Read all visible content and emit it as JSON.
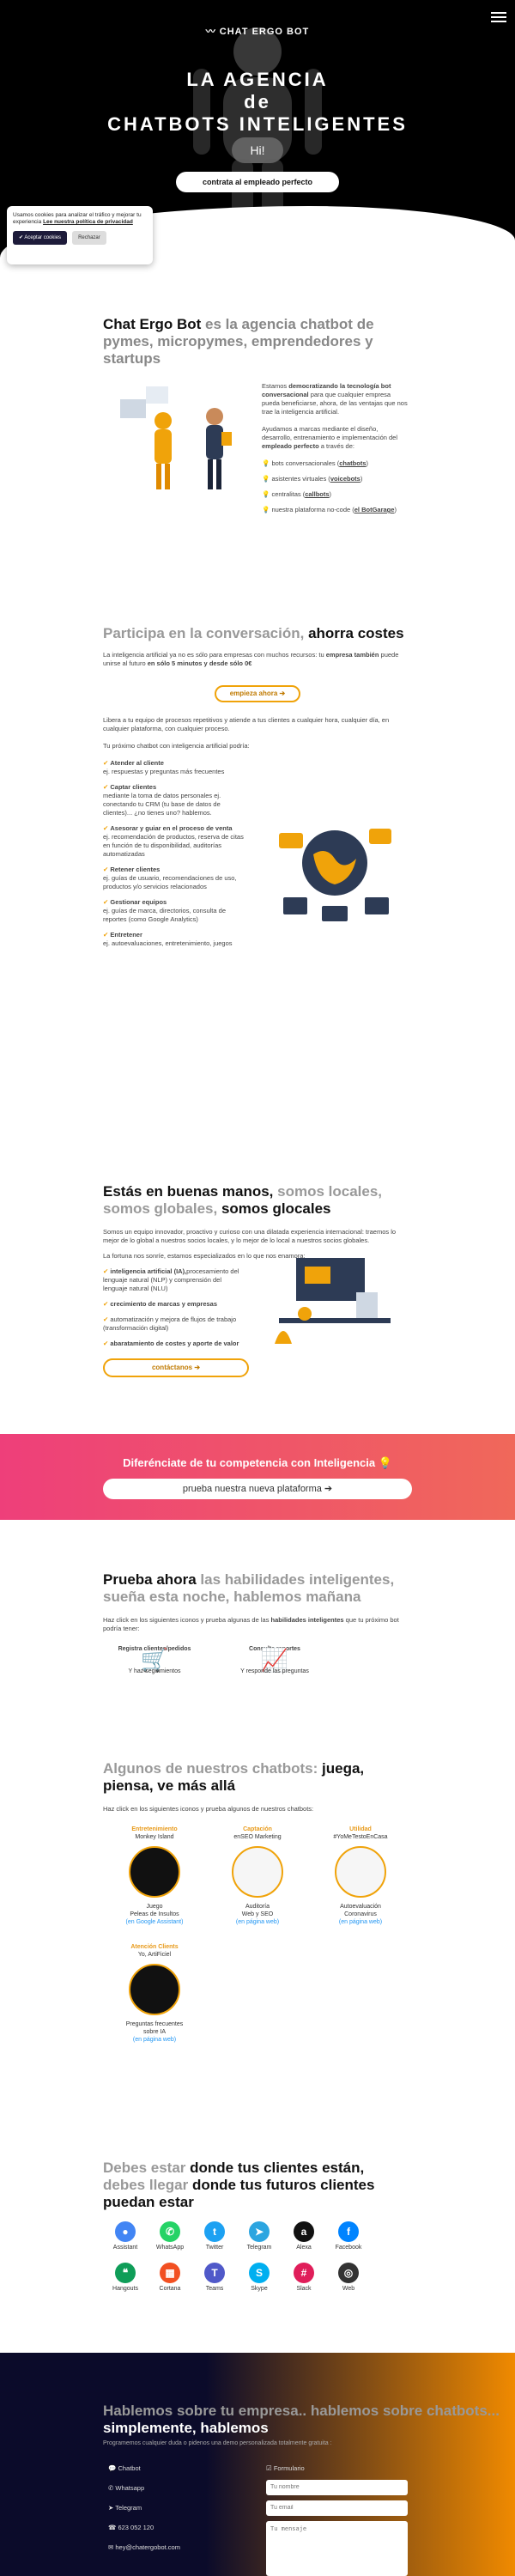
{
  "header": {
    "logo_text": "CHAT ERGO BOT",
    "title_line1": "LA AGENCIA",
    "title_line2": "de",
    "title_line3": "CHATBOTS INTELIGENTES",
    "bubble": "Hi!",
    "cta": "contrata al empleado perfecto"
  },
  "cookie": {
    "text": "Usamos cookies para analizar el tráfico y mejorar tu experiencia",
    "link": "Lee nuestra política de privacidad",
    "accept": "✔ Aceptar cookies",
    "reject": "Rechazar"
  },
  "intro": {
    "title_strong": "Chat Ergo Bot",
    "title_rest": "es la agencia chatbot de pymes, micropymes, emprendedores y startups",
    "p1_pre": "Estamos",
    "p1_b": "democratizando la tecnología bot conversacional",
    "p1_post": "para que cualquier empresa pueda beneficiarse, ahora, de las ventajas que nos trae la inteligencia artificial.",
    "p2_pre": "Ayudamos a marcas mediante el diseño, desarrollo, entrenamiento e implementación del",
    "p2_b": "empleado perfecto",
    "p2_post": "a través de:",
    "items": [
      {
        "pre": "bots conversacionales (",
        "link": "chatbots",
        "post": ")"
      },
      {
        "pre": "asistentes virtuales (",
        "link": "voicebots",
        "post": ")"
      },
      {
        "pre": "centralitas (",
        "link": "callbots",
        "post": ")"
      },
      {
        "pre": "nuestra plataforma no-code (",
        "link": "el BotGarage",
        "post": ")"
      }
    ]
  },
  "conv": {
    "title_g": "Participa en la conversación,",
    "title_b": "ahorra costes",
    "p1_pre": "La inteligencia artificial ya no es sólo para empresas con muchos recursos: tu",
    "p1_b": "empresa también",
    "p1_mid": "puede unirse al futuro",
    "p1_b2": "en sólo 5 minutos y desde sólo 0€",
    "btn": "empieza ahora ➔",
    "p2": "Libera a tu equipo de procesos repetitivos y atiende a tus clientes a cualquier hora, cualquier día, en cualquier plataforma, con cualquier proceso.",
    "p3": "Tu próximo chatbot con inteligencia artificial podría:",
    "features": [
      {
        "title": "Atender al cliente",
        "desc": "ej. respuestas y preguntas más frecuentes"
      },
      {
        "title": "Captar clientes",
        "desc": "mediante la toma de datos personales ej. conectando tu CRM (tu base de datos de clientes)... ¿no tienes uno? hablemos."
      },
      {
        "title": "Asesorar y guiar en el proceso de venta",
        "desc": "ej. recomendación de productos, reserva de citas en función de tu disponibilidad, auditorías automatizadas"
      },
      {
        "title": "Retener clientes",
        "desc": "ej. guías de usuario, recomendaciones de uso, productos y/o servicios relacionados"
      },
      {
        "title": "Gestionar equipos",
        "desc": "ej. guías de marca, directorios, consulta de reportes (como Google Analytics)"
      },
      {
        "title": "Entretener",
        "desc": "ej. autoevaluaciones, entretenimiento, juegos"
      }
    ]
  },
  "hands": {
    "title_b": "Estás en buenas manos,",
    "title_g": "somos locales, somos globales,",
    "title_b2": "somos glocales",
    "p1": "Somos un equipo innovador, proactivo y curioso con una dilatada experiencia internacional: traemos lo mejor de lo global a nuestros socios locales, y lo mejor de lo local a nuestros socios globales.",
    "p2": "La fortuna nos sonríe, estamos especializados en lo que nos enamora:",
    "items": [
      {
        "b": "inteligencia artificial (IA),",
        "rest": "procesamiento del lenguaje natural (NLP) y comprensión del lenguaje natural (NLU)"
      },
      {
        "b": "crecimiento de marcas y empresas",
        "rest": ""
      },
      {
        "b": "",
        "rest": "automatización y mejora de flujos de trabajo (transformación digital)"
      },
      {
        "b": "abaratamiento de costes y aporte de valor",
        "rest": ""
      }
    ],
    "btn": "contáctanos ➔"
  },
  "banner": {
    "title": "Diferénciate de tu competencia con Inteligencia 💡",
    "btn": "prueba nuestra nueva plataforma ➔"
  },
  "try": {
    "title_b": "Prueba ahora",
    "title_g": "las habilidades inteligentes, sueña esta noche, hablemos mañana",
    "p_pre": "Haz click en los siguientes iconos y prueba algunas de las",
    "p_b": "habilidades inteligentes",
    "p_post": "que tu próximo bot podría tener:",
    "cards": [
      {
        "label": "Registra clientes/pedidos",
        "caption": "Y haz seguimientos",
        "icon": "cart-icon"
      },
      {
        "label": "Consulta reportes",
        "caption": "Y responde las preguntas",
        "icon": "chart-icon"
      }
    ]
  },
  "bots": {
    "title_g": "Algunos de nuestros chatbots:",
    "title_b": "juega, piensa, ve más allá",
    "p": "Haz click en los siguientes iconos y prueba algunos de nuestros chatbots:",
    "cards": [
      {
        "cat": "Entretenimiento",
        "name": "Monkey Island",
        "d1": "Juego",
        "d2": "Peleas de Insultos",
        "link": "(en Google Assistant)"
      },
      {
        "cat": "Captación",
        "name": "enSEO Marketing",
        "d1": "Auditoría",
        "d2": "Web y SEO",
        "link": "(en página web)"
      },
      {
        "cat": "Utilidad",
        "name": "#YoMeTestoEnCasa",
        "d1": "Autoevaluación",
        "d2": "Coronavirus",
        "link": "(en página web)"
      },
      {
        "cat": "Atención Clients",
        "name": "Yo, ArtiFiciel",
        "d1": "Preguntas frecuentes",
        "d2": "sobre IA",
        "link": "(en página web)"
      }
    ]
  },
  "channels": {
    "title_b1": "Debes estar",
    "title_g1": "donde tus clientes están,",
    "title_b2": "debes llegar",
    "title_g2": "donde tus futuros clientes",
    "title_b3": "puedan estar",
    "items": [
      {
        "label": "Assistant",
        "color": "#4285f4",
        "glyph": "●"
      },
      {
        "label": "WhatsApp",
        "color": "#25d366",
        "glyph": "✆"
      },
      {
        "label": "Twitter",
        "color": "#1da1f2",
        "glyph": "t"
      },
      {
        "label": "Telegram",
        "color": "#2ca5e0",
        "glyph": "➤"
      },
      {
        "label": "Alexa",
        "color": "#111111",
        "glyph": "a"
      },
      {
        "label": "Facebook",
        "color": "#0084ff",
        "glyph": "f"
      },
      {
        "label": "Hangouts",
        "color": "#0f9d58",
        "glyph": "❝"
      },
      {
        "label": "Cortana",
        "color": "#f25022",
        "glyph": "▦"
      },
      {
        "label": "Teams",
        "color": "#5059c9",
        "glyph": "T"
      },
      {
        "label": "Skype",
        "color": "#00aff0",
        "glyph": "S"
      },
      {
        "label": "Slack",
        "color": "#e01e5a",
        "glyph": "#"
      },
      {
        "label": "Web",
        "color": "#333333",
        "glyph": "◎"
      }
    ]
  },
  "footer": {
    "title_g": "Hablemos sobre tu empresa.. hablemos sobre chatbots...",
    "title_b": "simplemente, hablemos",
    "sub": "Programemos cualquier duda o pidenos una demo personalizada totalmente gratuita :",
    "links": [
      "Chatbot",
      "Whatsapp",
      "Telegram",
      "623 052 120",
      "hey@chatergobot.com"
    ],
    "form_label": "Formulario",
    "name_ph": "Tu nombre",
    "email_ph": "Tu email",
    "msg_ph": "Tu mensaje"
  }
}
